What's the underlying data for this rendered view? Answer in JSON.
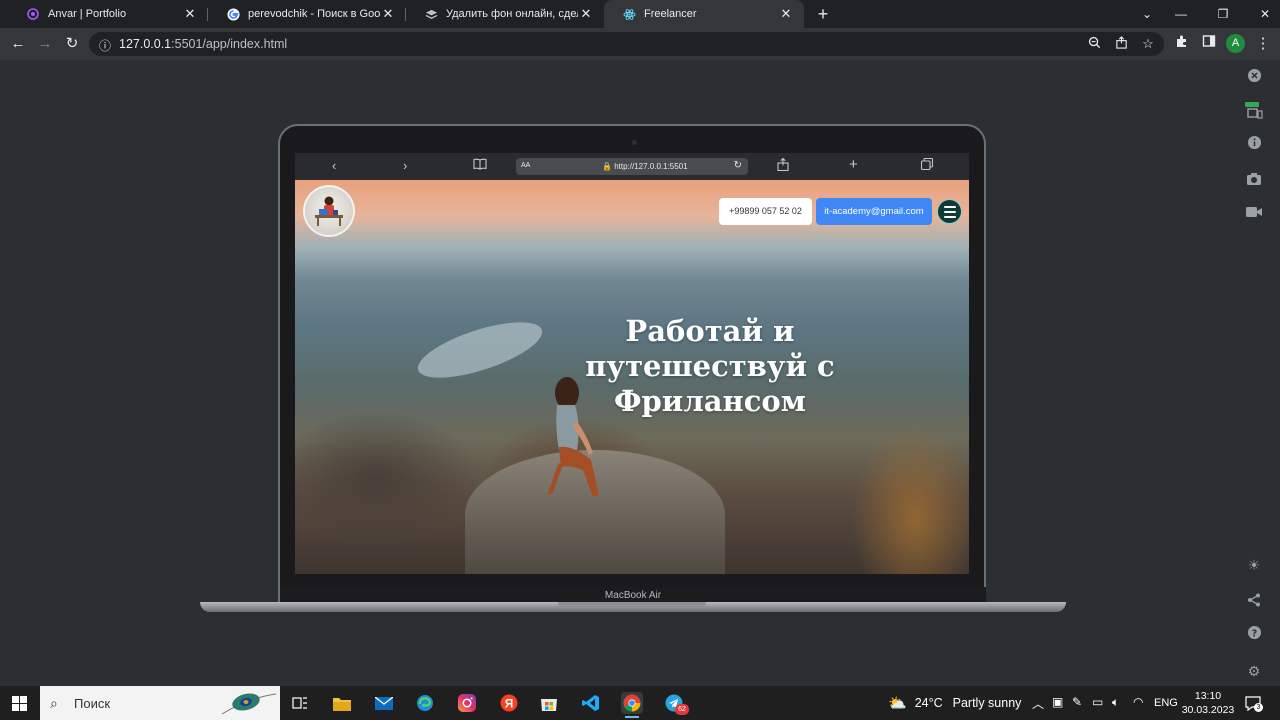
{
  "tabs": [
    {
      "title": "Anvar | Portfolio",
      "favicon": "portfolio-icon",
      "active": false
    },
    {
      "title": "perevodchik - Поиск в Google",
      "favicon": "google-icon",
      "active": false
    },
    {
      "title": "Удалить фон онлайн, сделать п",
      "favicon": "layers-icon",
      "active": false
    },
    {
      "title": "Freelancer",
      "favicon": "react-icon",
      "active": true
    }
  ],
  "address": {
    "host": "127.0.0.1",
    "path": ":5501/app/index.html"
  },
  "profile_initial": "A",
  "mockup": {
    "safari_url": "http://127.0.0.1:5501",
    "safari_aa": "AA",
    "device_label": "MacBook Air"
  },
  "site": {
    "phone": "+99899 057 52 02",
    "email": "it-academy@gmail.com",
    "headline_lines": [
      "Работай и",
      "путешествуй с",
      "Фрилансом"
    ]
  },
  "taskbar": {
    "search_label": "Поиск",
    "telegram_badge": "62",
    "weather_temp": "24°C",
    "weather_text": "Partly sunny",
    "lang": "ENG",
    "time": "13:10",
    "date": "30.03.2023",
    "notif_count": "3"
  },
  "colors": {
    "accent_blue": "#3f87f5",
    "burger_bg": "#0e3b35",
    "chrome_bg": "#202124",
    "toolbar_bg": "#35363a"
  }
}
